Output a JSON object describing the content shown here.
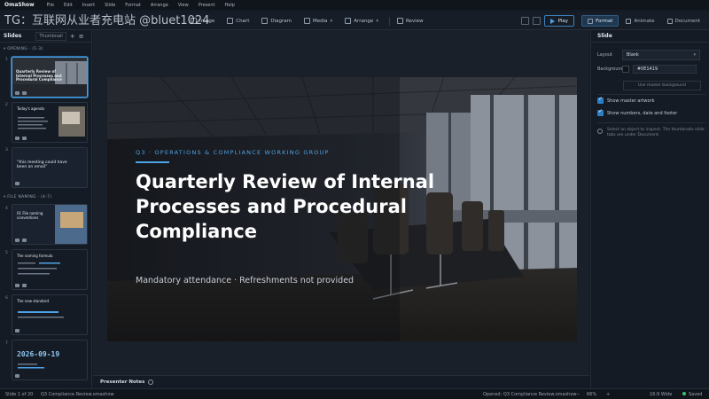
{
  "app": {
    "brand": "OmaShow"
  },
  "menu": [
    "File",
    "Edit",
    "Insert",
    "Slide",
    "Format",
    "Arrange",
    "View",
    "Present",
    "Help"
  ],
  "watermark": "TG：互联网从业者充电站 @bluet1024",
  "toolbar": {
    "items": [
      {
        "label": "Image",
        "icon": "image-icon"
      },
      {
        "label": "Chart",
        "icon": "chart-icon"
      },
      {
        "label": "Diagram",
        "icon": "diagram-icon"
      },
      {
        "label": "Media",
        "icon": "media-icon"
      },
      {
        "label": "Arrange",
        "icon": "arrange-icon"
      },
      {
        "label": "Review",
        "icon": "review-icon"
      }
    ],
    "play_label": "Play",
    "tabs": [
      {
        "label": "Format",
        "icon": "format-icon",
        "active": true
      },
      {
        "label": "Animate",
        "icon": "animate-icon",
        "active": false
      },
      {
        "label": "Document",
        "icon": "document-icon",
        "active": false
      }
    ]
  },
  "slides_panel": {
    "title": "Slides",
    "view_select": "Thumbnail",
    "sections": [
      {
        "label": "OPENING · (1-3)"
      },
      {
        "label": "FILE NAMING · (4-7)"
      }
    ],
    "thumbs": [
      {
        "num": "1",
        "text": "Quarterly Review of Internal Processes and Procedural Compliance"
      },
      {
        "num": "2",
        "text": "Today's agenda"
      },
      {
        "num": "3",
        "text": "“this meeting could have been an email”"
      },
      {
        "num": "4",
        "text": "01 File naming conventions"
      },
      {
        "num": "5",
        "text": "The naming formula"
      },
      {
        "num": "6",
        "text": "The new standard"
      },
      {
        "num": "7",
        "text": "2026-09-19"
      }
    ]
  },
  "slide": {
    "kicker": "Q3 · OPERATIONS & COMPLIANCE WORKING GROUP",
    "title": "Quarterly Review of Internal Processes and Procedural Compliance",
    "subtitle": "Mandatory attendance  ·  Refreshments not provided"
  },
  "notes": {
    "label": "Presenter Notes"
  },
  "props": {
    "title": "Slide",
    "layout_label": "Layout",
    "layout_value": "Blank",
    "background_label": "Background",
    "background_value": "#0E1419",
    "background_button": "Use master background",
    "check_master_artwork": "Show master artwork",
    "check_numbers": "Show numbers, date and footer",
    "hint": "Select an object to inspect. The thumbnails slide tabs are under Document."
  },
  "status": {
    "slide_count": "Slide 1 of 20",
    "file_name": "Q3 Compliance Review.omashow",
    "opened_label": "Opened: Q3 Compliance Review.omashow",
    "zoom": "66%",
    "aspect": "16:9 Wide",
    "saved": "Saved"
  },
  "colors": {
    "accent": "#4da3e6",
    "active_border": "#4da3e6",
    "bg": "#151b24"
  }
}
